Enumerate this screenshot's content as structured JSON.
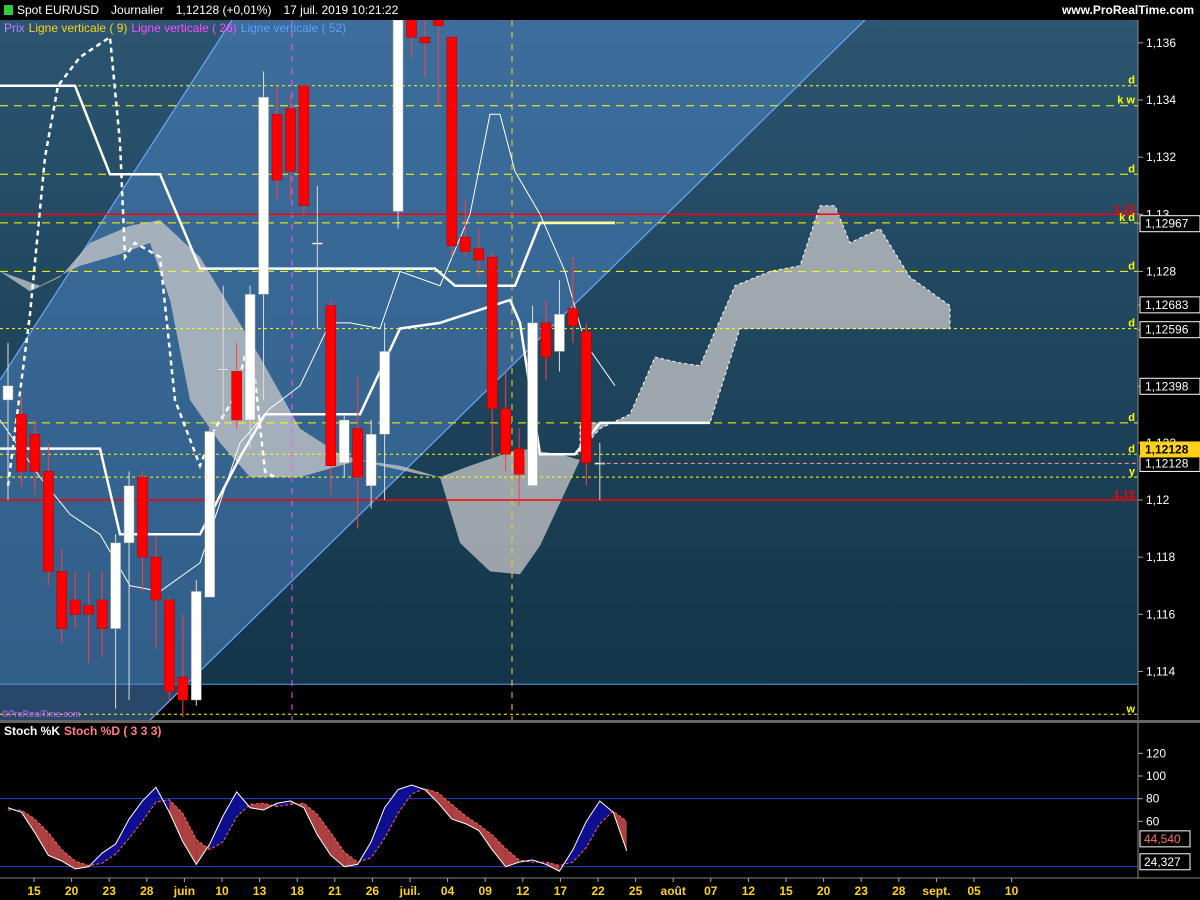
{
  "header": {
    "instrument": "Spot EUR/USD",
    "period": "Journalier",
    "price": "1,12128 (+0,01%)",
    "datetime": "17 juil. 2019 10:21:22",
    "website": "www.ProRealTime.com"
  },
  "legend": [
    {
      "label": "Prix",
      "color": "#c080ff"
    },
    {
      "label": "Ligne verticale ( 9)",
      "color": "#ffd21a"
    },
    {
      "label": "Ligne verticale ( 26)",
      "color": "#ff4dff"
    },
    {
      "label": "Ligne verticale ( 52)",
      "color": "#5aa0ff"
    }
  ],
  "watermark": "©ProRealTime.com",
  "stoch_legend": [
    {
      "label": "Stoch %K",
      "color": "#ffffff"
    },
    {
      "label": "Stoch %D ( 3 3 3)",
      "color": "#ff8080"
    }
  ],
  "chart_data": [
    {
      "type": "candlestick",
      "title": "Spot EUR/USD",
      "ylim": [
        1.1123,
        1.1368
      ],
      "yticks": [
        "1,114",
        "1,116",
        "1,118",
        "1,12",
        "1,122",
        "1,12398",
        "1,12596",
        "1,12683",
        "1,128",
        "1,12967",
        "1,13",
        "1,132",
        "1,134",
        "1,136"
      ],
      "xticks": [
        "15",
        "20",
        "23",
        "28",
        "juin",
        "10",
        "13",
        "18",
        "21",
        "26",
        "juil.",
        "04",
        "09",
        "12",
        "17",
        "22",
        "25",
        "août",
        "07",
        "12",
        "15",
        "20",
        "23",
        "28",
        "sept.",
        "05",
        "10"
      ],
      "candles": [
        {
          "o": 1.1235,
          "h": 1.1255,
          "l": 1.12,
          "c": 1.124
        },
        {
          "o": 1.123,
          "h": 1.1236,
          "l": 1.1205,
          "c": 1.121
        },
        {
          "o": 1.1223,
          "h": 1.1228,
          "l": 1.1202,
          "c": 1.121
        },
        {
          "o": 1.121,
          "h": 1.122,
          "l": 1.117,
          "c": 1.1175
        },
        {
          "o": 1.1175,
          "h": 1.1183,
          "l": 1.115,
          "c": 1.1155
        },
        {
          "o": 1.1165,
          "h": 1.1175,
          "l": 1.1155,
          "c": 1.116
        },
        {
          "o": 1.1163,
          "h": 1.1175,
          "l": 1.1143,
          "c": 1.116
        },
        {
          "o": 1.1165,
          "h": 1.1175,
          "l": 1.1145,
          "c": 1.1155
        },
        {
          "o": 1.1155,
          "h": 1.1188,
          "l": 1.1127,
          "c": 1.1185
        },
        {
          "o": 1.1185,
          "h": 1.121,
          "l": 1.113,
          "c": 1.1205
        },
        {
          "o": 1.1208,
          "h": 1.121,
          "l": 1.1168,
          "c": 1.118
        },
        {
          "o": 1.118,
          "h": 1.1187,
          "l": 1.1148,
          "c": 1.1165
        },
        {
          "o": 1.1165,
          "h": 1.1166,
          "l": 1.113,
          "c": 1.1133
        },
        {
          "o": 1.1138,
          "h": 1.116,
          "l": 1.1124,
          "c": 1.113
        },
        {
          "o": 1.113,
          "h": 1.1172,
          "l": 1.1128,
          "c": 1.1168
        },
        {
          "o": 1.1166,
          "h": 1.1225,
          "l": 1.1166,
          "c": 1.1224
        },
        {
          "o": 1.1246,
          "h": 1.1275,
          "l": 1.1228,
          "c": 1.1246
        },
        {
          "o": 1.1245,
          "h": 1.1255,
          "l": 1.1225,
          "c": 1.1228
        },
        {
          "o": 1.1228,
          "h": 1.1275,
          "l": 1.1218,
          "c": 1.1272
        },
        {
          "o": 1.1272,
          "h": 1.135,
          "l": 1.1235,
          "c": 1.1341
        },
        {
          "o": 1.1335,
          "h": 1.1345,
          "l": 1.1305,
          "c": 1.1312
        },
        {
          "o": 1.1337,
          "h": 1.1342,
          "l": 1.1305,
          "c": 1.1315
        },
        {
          "o": 1.1345,
          "h": 1.1345,
          "l": 1.13,
          "c": 1.1303
        },
        {
          "o": 1.129,
          "h": 1.131,
          "l": 1.126,
          "c": 1.129
        },
        {
          "o": 1.1268,
          "h": 1.127,
          "l": 1.1202,
          "c": 1.1212
        },
        {
          "o": 1.1213,
          "h": 1.123,
          "l": 1.1208,
          "c": 1.1228
        },
        {
          "o": 1.1225,
          "h": 1.1243,
          "l": 1.119,
          "c": 1.1208
        },
        {
          "o": 1.1205,
          "h": 1.1228,
          "l": 1.1197,
          "c": 1.1223
        },
        {
          "o": 1.1223,
          "h": 1.1262,
          "l": 1.12,
          "c": 1.1252
        },
        {
          "o": 1.1301,
          "h": 1.1368,
          "l": 1.1295,
          "c": 1.1368
        },
        {
          "o": 1.1368,
          "h": 1.1368,
          "l": 1.1355,
          "c": 1.1362
        },
        {
          "o": 1.1362,
          "h": 1.1368,
          "l": 1.1348,
          "c": 1.136
        },
        {
          "o": 1.1368,
          "h": 1.1368,
          "l": 1.1338,
          "c": 1.1366
        },
        {
          "o": 1.1362,
          "h": 1.1362,
          "l": 1.1285,
          "c": 1.1289
        },
        {
          "o": 1.1292,
          "h": 1.1305,
          "l": 1.1285,
          "c": 1.1287
        },
        {
          "o": 1.1288,
          "h": 1.1295,
          "l": 1.1278,
          "c": 1.1284
        },
        {
          "o": 1.1285,
          "h": 1.1287,
          "l": 1.1215,
          "c": 1.1232
        },
        {
          "o": 1.1232,
          "h": 1.1245,
          "l": 1.121,
          "c": 1.1216
        },
        {
          "o": 1.1218,
          "h": 1.1225,
          "l": 1.1198,
          "c": 1.1209
        },
        {
          "o": 1.1205,
          "h": 1.1268,
          "l": 1.1205,
          "c": 1.1262
        },
        {
          "o": 1.1262,
          "h": 1.127,
          "l": 1.1242,
          "c": 1.125
        },
        {
          "o": 1.1252,
          "h": 1.1277,
          "l": 1.1245,
          "c": 1.1265
        },
        {
          "o": 1.1267,
          "h": 1.1285,
          "l": 1.1255,
          "c": 1.1261
        },
        {
          "o": 1.1259,
          "h": 1.1262,
          "l": 1.1205,
          "c": 1.1213
        },
        {
          "o": 1.1213,
          "h": 1.122,
          "l": 1.12,
          "c": 1.1213
        }
      ],
      "hlines": [
        {
          "y": 1.13,
          "label": "1,13",
          "color": "#ff0000",
          "style": "solid"
        },
        {
          "y": 1.12,
          "label": "1,12",
          "color": "#ff0000",
          "style": "solid"
        },
        {
          "y": 1.1345,
          "label": "d",
          "color": "#ffff00",
          "style": "dotted"
        },
        {
          "y": 1.1338,
          "label": "k w",
          "color": "#ffff00",
          "style": "dashed"
        },
        {
          "y": 1.1314,
          "label": "d",
          "color": "#ffff00",
          "style": "dashed"
        },
        {
          "y": 1.1297,
          "label": "k d",
          "color": "#ffff00",
          "style": "dashed"
        },
        {
          "y": 1.128,
          "label": "d",
          "color": "#ffff00",
          "style": "dashed"
        },
        {
          "y": 1.126,
          "label": "d",
          "color": "#ffff00",
          "style": "dotted"
        },
        {
          "y": 1.1227,
          "label": "d",
          "color": "#ffff00",
          "style": "dashed"
        },
        {
          "y": 1.1216,
          "label": "d",
          "color": "#ffff00",
          "style": "dotted"
        },
        {
          "y": 1.1208,
          "label": "y",
          "color": "#ffff00",
          "style": "dotted"
        },
        {
          "y": 1.1125,
          "label": "w",
          "color": "#ffff00",
          "style": "dotted"
        }
      ],
      "price_boxes": [
        {
          "value": "1,12967",
          "y": 1.12967
        },
        {
          "value": "1,12683",
          "y": 1.12683
        },
        {
          "value": "1,12596",
          "y": 1.12596
        },
        {
          "value": "1,12398",
          "y": 1.12398
        },
        {
          "value": "1,12128",
          "y": 1.12128
        }
      ],
      "current_price": {
        "value": "1,12128",
        "y": 1.12128
      },
      "colors": {
        "up": "#ffffff",
        "down": "#ff0000",
        "bg_top": "#2b5570",
        "bg_bottom": "#123347",
        "channel": "#3a6ea8",
        "cloud": "#c0c0c0"
      }
    },
    {
      "type": "line",
      "title": "Stoch %K / Stoch %D",
      "ylim": [
        10,
        130
      ],
      "yticks": [
        "120",
        "100",
        "80",
        "60"
      ],
      "levels": [
        80,
        20
      ],
      "last_values": [
        {
          "value": "44,540",
          "y": 44.54
        },
        {
          "value": "24,327",
          "y": 24.327
        }
      ],
      "series": [
        {
          "name": "Stoch %K",
          "color": "#ffffff",
          "values": [
            72,
            68,
            50,
            30,
            25,
            18,
            20,
            32,
            40,
            62,
            78,
            90,
            68,
            42,
            22,
            40,
            65,
            86,
            72,
            70,
            76,
            78,
            72,
            48,
            30,
            20,
            22,
            42,
            72,
            88,
            92,
            88,
            76,
            62,
            58,
            52,
            35,
            20,
            24,
            26,
            22,
            16,
            35,
            60,
            78,
            68,
            34
          ]
        },
        {
          "name": "Stoch %D",
          "color": "#ff6060",
          "values": [
            70,
            70,
            62,
            50,
            35,
            25,
            21,
            23,
            31,
            45,
            60,
            77,
            79,
            67,
            44,
            35,
            42,
            64,
            75,
            76,
            73,
            75,
            76,
            66,
            50,
            33,
            24,
            28,
            45,
            67,
            84,
            89,
            85,
            75,
            65,
            57,
            48,
            36,
            26,
            24,
            24,
            21,
            24,
            37,
            58,
            69,
            60
          ]
        }
      ]
    }
  ]
}
